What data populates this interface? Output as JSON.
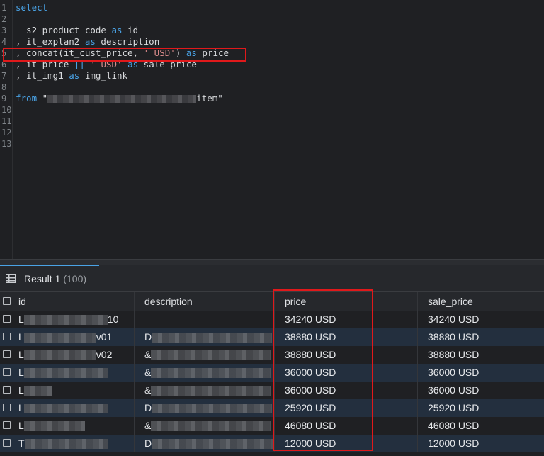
{
  "editor": {
    "lines": [
      {
        "n": "1",
        "code": [
          {
            "t": "kw",
            "v": "select"
          }
        ]
      },
      {
        "n": "2",
        "code": []
      },
      {
        "n": "3",
        "code": [
          {
            "t": "txt",
            "v": "  s2_product_code "
          },
          {
            "t": "kw",
            "v": "as"
          },
          {
            "t": "txt",
            "v": " id"
          }
        ]
      },
      {
        "n": "4",
        "code": [
          {
            "t": "txt",
            "v": ", it_explan2 "
          },
          {
            "t": "kw",
            "v": "as"
          },
          {
            "t": "txt",
            "v": " description"
          }
        ]
      },
      {
        "n": "5",
        "code": [
          {
            "t": "txt",
            "v": ", concat(it_cust_price, "
          },
          {
            "t": "str",
            "v": "' USD'"
          },
          {
            "t": "txt",
            "v": ") "
          },
          {
            "t": "kw",
            "v": "as"
          },
          {
            "t": "txt",
            "v": " price"
          }
        ]
      },
      {
        "n": "6",
        "code": [
          {
            "t": "txt",
            "v": ", it_price "
          },
          {
            "t": "kw",
            "v": "||"
          },
          {
            "t": "txt",
            "v": " "
          },
          {
            "t": "str",
            "v": "' USD'"
          },
          {
            "t": "txt",
            "v": " "
          },
          {
            "t": "kw",
            "v": "as"
          },
          {
            "t": "txt",
            "v": " sale_price"
          }
        ]
      },
      {
        "n": "7",
        "code": [
          {
            "t": "txt",
            "v": ", it_img1 "
          },
          {
            "t": "kw",
            "v": "as"
          },
          {
            "t": "txt",
            "v": " img_link"
          }
        ]
      },
      {
        "n": "8",
        "code": []
      },
      {
        "n": "9",
        "code": [
          {
            "t": "kw",
            "v": "from"
          },
          {
            "t": "txt",
            "v": " \""
          },
          {
            "t": "blur",
            "w": 210
          },
          {
            "t": "txt",
            "v": "item\""
          }
        ]
      },
      {
        "n": "10",
        "code": []
      },
      {
        "n": "11",
        "code": []
      },
      {
        "n": "12",
        "code": []
      },
      {
        "n": "13",
        "code": []
      }
    ]
  },
  "result": {
    "tab_label": "Result 1",
    "count": "(100)",
    "columns": [
      "id",
      "description",
      "price",
      "sale_price"
    ],
    "rows": [
      {
        "id_prefix": "L",
        "id_suffix": "10",
        "desc_prefix": "",
        "price": "34240 USD",
        "sale_price": "34240 USD"
      },
      {
        "id_prefix": "L",
        "id_suffix": "v01",
        "desc_prefix": "D",
        "price": "38880 USD",
        "sale_price": "38880 USD"
      },
      {
        "id_prefix": "L",
        "id_suffix": "v02",
        "desc_prefix": "&",
        "price": "38880 USD",
        "sale_price": "38880 USD"
      },
      {
        "id_prefix": "L",
        "id_suffix": "",
        "desc_prefix": "&",
        "price": "36000 USD",
        "sale_price": "36000 USD"
      },
      {
        "id_prefix": "L",
        "id_suffix": "",
        "desc_prefix": "&",
        "price": "36000 USD",
        "sale_price": "36000 USD"
      },
      {
        "id_prefix": "L",
        "id_suffix": "",
        "desc_prefix": "D",
        "price": "25920 USD",
        "sale_price": "25920 USD"
      },
      {
        "id_prefix": "L",
        "id_suffix": "",
        "desc_prefix": "&",
        "price": "46080 USD",
        "sale_price": "46080 USD"
      },
      {
        "id_prefix": "T",
        "id_suffix": "",
        "desc_prefix": "D",
        "price": "12000 USD",
        "sale_price": "12000 USD"
      }
    ]
  },
  "colors": {
    "highlight": "#e0191b",
    "keyword": "#4aa3e6",
    "string": "#d98a8a",
    "accent": "#4aa3e6"
  }
}
